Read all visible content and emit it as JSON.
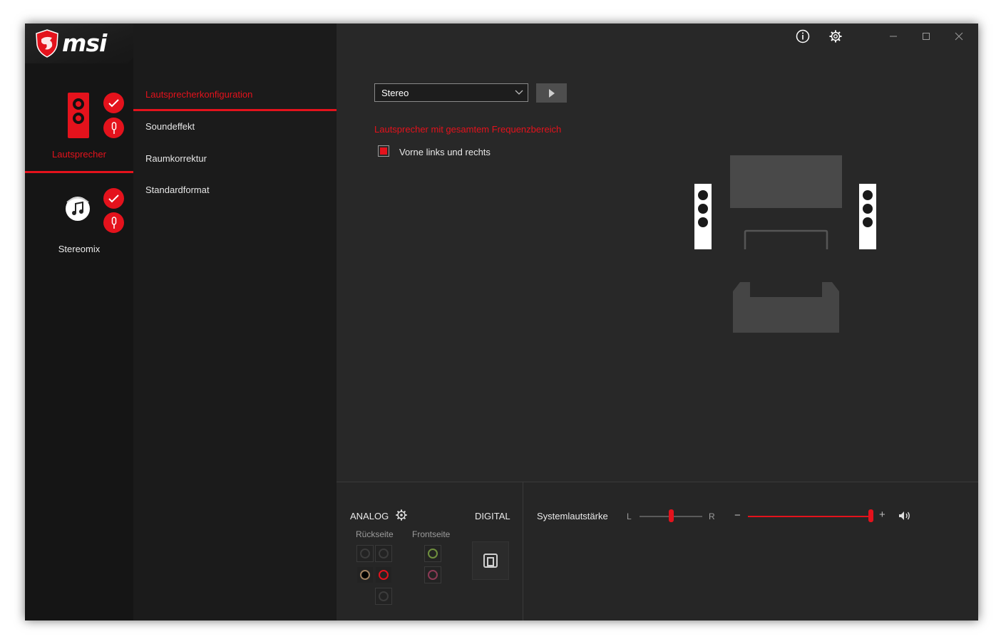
{
  "app": {
    "brand": "msi",
    "accent_color": "#e4121c"
  },
  "devices": [
    {
      "label": "Lautsprecher",
      "icon": "speaker-icon",
      "active": true
    },
    {
      "label": "Stereomix",
      "icon": "music-note-icon",
      "active": false
    }
  ],
  "menu": {
    "items": [
      {
        "label": "Lautsprecherkonfiguration",
        "active": true
      },
      {
        "label": "Soundeffekt",
        "active": false
      },
      {
        "label": "Raumkorrektur",
        "active": false
      },
      {
        "label": "Standardformat",
        "active": false
      }
    ]
  },
  "titlebar": {
    "icons": [
      "info-icon",
      "gear-icon",
      "minimize-icon",
      "maximize-icon",
      "close-icon"
    ]
  },
  "config": {
    "speaker_select": "Stereo",
    "fullrange_heading": "Lautsprecher mit gesamtem Frequenzbereich",
    "front_lr_label": "Vorne links und rechts",
    "front_lr_checked": true
  },
  "bottom": {
    "analog_label": "ANALOG",
    "digital_label": "DIGITAL",
    "rear_label": "Rückseite",
    "front_label": "Frontseite",
    "volume_label": "Systemlautstärke",
    "balance_left": "L",
    "balance_right": "R",
    "minus": "−",
    "plus": "+",
    "balance_value": 0.5,
    "volume_value": 1.0
  }
}
